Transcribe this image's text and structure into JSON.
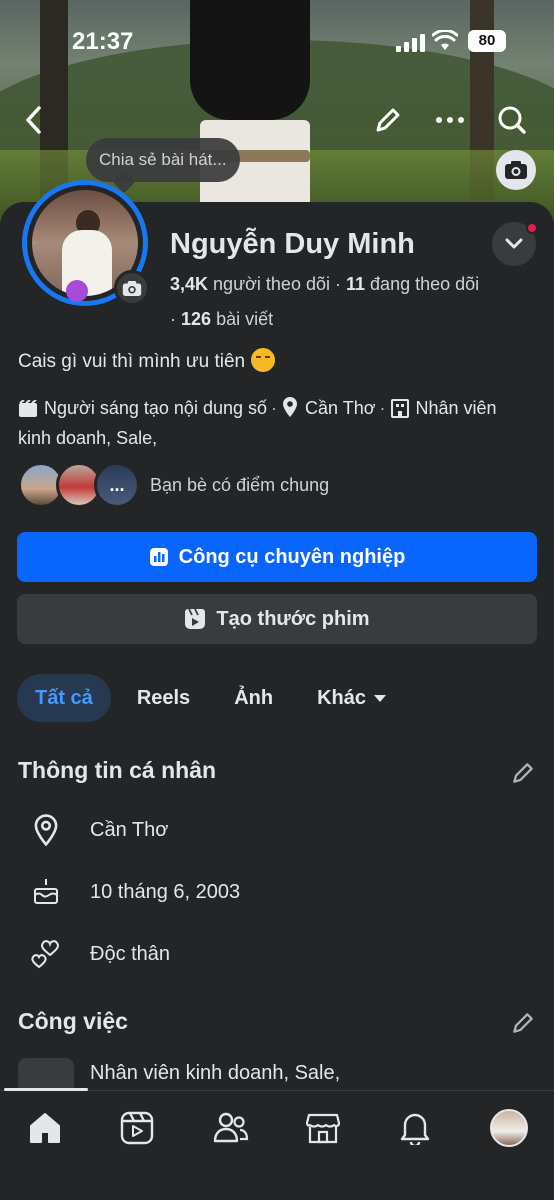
{
  "status_bar": {
    "time": "21:37",
    "battery": "80"
  },
  "cover": {
    "song_prompt": "Chia sẻ bài hát..."
  },
  "profile": {
    "name": "Nguyễn Duy Minh",
    "followers_count": "3,4K",
    "followers_label": "người theo dõi",
    "following_count": "11",
    "following_label": "đang theo dõi",
    "posts_count": "126",
    "posts_label": "bài viết",
    "bio": "Cais gì vui thì mình ưu tiên",
    "category": "Người sáng tạo nội dung số",
    "location": "Cần Thơ",
    "job_inline_1": "Nhân viên",
    "job_inline_2": "kinh doanh, Sale,",
    "mutual_friends": "Bạn bè có điểm chung",
    "mutual_more": "..."
  },
  "buttons": {
    "professional_tools": "Công cụ chuyên nghiệp",
    "create_reel": "Tạo thước phim"
  },
  "tabs": [
    {
      "label": "Tất cả",
      "active": true
    },
    {
      "label": "Reels",
      "active": false
    },
    {
      "label": "Ảnh",
      "active": false
    },
    {
      "label": "Khác",
      "active": false
    }
  ],
  "personal_info": {
    "title": "Thông tin cá nhân",
    "location": "Cần Thơ",
    "birthday": "10 tháng 6, 2003",
    "relationship": "Độc thân"
  },
  "work": {
    "title": "Công việc",
    "job": "Nhân viên kinh doanh, Sale,"
  },
  "icons": {
    "back": "chevron-left-icon",
    "edit": "pencil-icon",
    "more": "more-icon",
    "search": "search-icon",
    "camera": "camera-icon",
    "home": "home-icon",
    "video": "video-icon",
    "friends": "friends-icon",
    "marketplace": "marketplace-icon",
    "notifications": "bell-icon"
  },
  "colors": {
    "accent": "#0866ff",
    "background": "#242526",
    "surface": "#3a3b3c",
    "active_tab_bg": "#263951",
    "active_tab_text": "#4599ff",
    "notification_dot": "#e41e3f"
  }
}
